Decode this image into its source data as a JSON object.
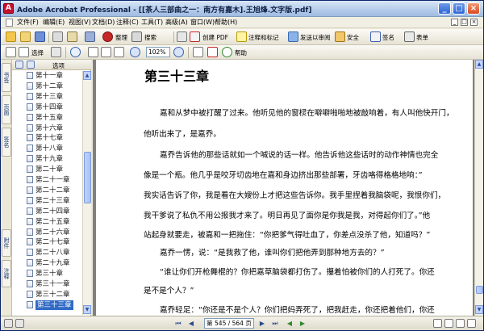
{
  "window": {
    "app_icon": "acrobat-icon",
    "title": "Adobe Acrobat Professional - [[茶人三部曲之一：南方有嘉木].王旭烽.文字版.pdf]",
    "buttons": [
      "_",
      "□",
      "×"
    ]
  },
  "menu": {
    "items": [
      "文件(F)",
      "编辑(E)",
      "视图(V)",
      "文档(D)",
      "注释(C)",
      "工具(T)",
      "高级(A)",
      "窗口(W)",
      "帮助(H)"
    ]
  },
  "toolbar1": {
    "labels": {
      "organize": "整理",
      "search": "搜索",
      "create_pdf": "创建 PDF",
      "review": "注释和标记",
      "send_review": "发送以审阅",
      "secure": "安全",
      "sign": "签名",
      "forms": "表单"
    }
  },
  "toolbar2": {
    "select_label": "选择",
    "zoom": "102%",
    "help": "帮助"
  },
  "side_tabs": [
    "书签",
    "页面",
    "签名",
    "附件",
    "注释"
  ],
  "bookmarks": {
    "options_label": "选项",
    "items": [
      "第十一章",
      "第十二章",
      "第十三章",
      "第十四章",
      "第十五章",
      "第十六章",
      "第十七章",
      "第十八章",
      "第十九章",
      "第二十章",
      "第二十一章",
      "第二十二章",
      "第二十三章",
      "第二十四章",
      "第二十五章",
      "第二十六章",
      "第二十七章",
      "第二十八章",
      "第二十九章",
      "第三十章",
      "第三十一章",
      "第三十二章",
      "第三十三章"
    ],
    "selected_index": 22
  },
  "document": {
    "heading": "第三十三章",
    "lines": [
      "嘉和从梦中被打醒了过来。他听见他的窗棂在噼噼啪啪地被敲响着，有人叫他快开门，",
      "他听出来了，是嘉乔。",
      "嘉乔告诉他的那些话就如一个喊说的话一样。他告诉他这些话时的动作神情也完全",
      "像是一个瓶。他几乎是咬牙切齿地在嘉和身边挤出那些部署，牙齿咯得格格地响：”",
      "我实话告诉了你，我是看在大嫂份上才把这些告诉你。我手里捏着我脑袋呢，我恨你们，",
      "我干爹说了私仇不用公报我才来了。明日再见了面你是你我是我，对得起你们了。”他",
      "站起身就要走，被嘉和一把拖住：“你把爹气得吐血了，你差点没杀了他，知道吗？”",
      "嘉乔一愣，说：“是我救了他，谁叫你们把他弄到那种地方去的？”",
      "“谁让你们开枪舞棍的？你把嘉草脑袋都打伤了。攥着怕被你们的人打死了。你还",
      "是不是个人？”",
      "嘉乔轻足：“你还是不是个人？你们把妈弄死了，把我赶走，你还把着他们，你还"
    ]
  },
  "statusbar": {
    "page_display": "第 545 / 564 页"
  }
}
